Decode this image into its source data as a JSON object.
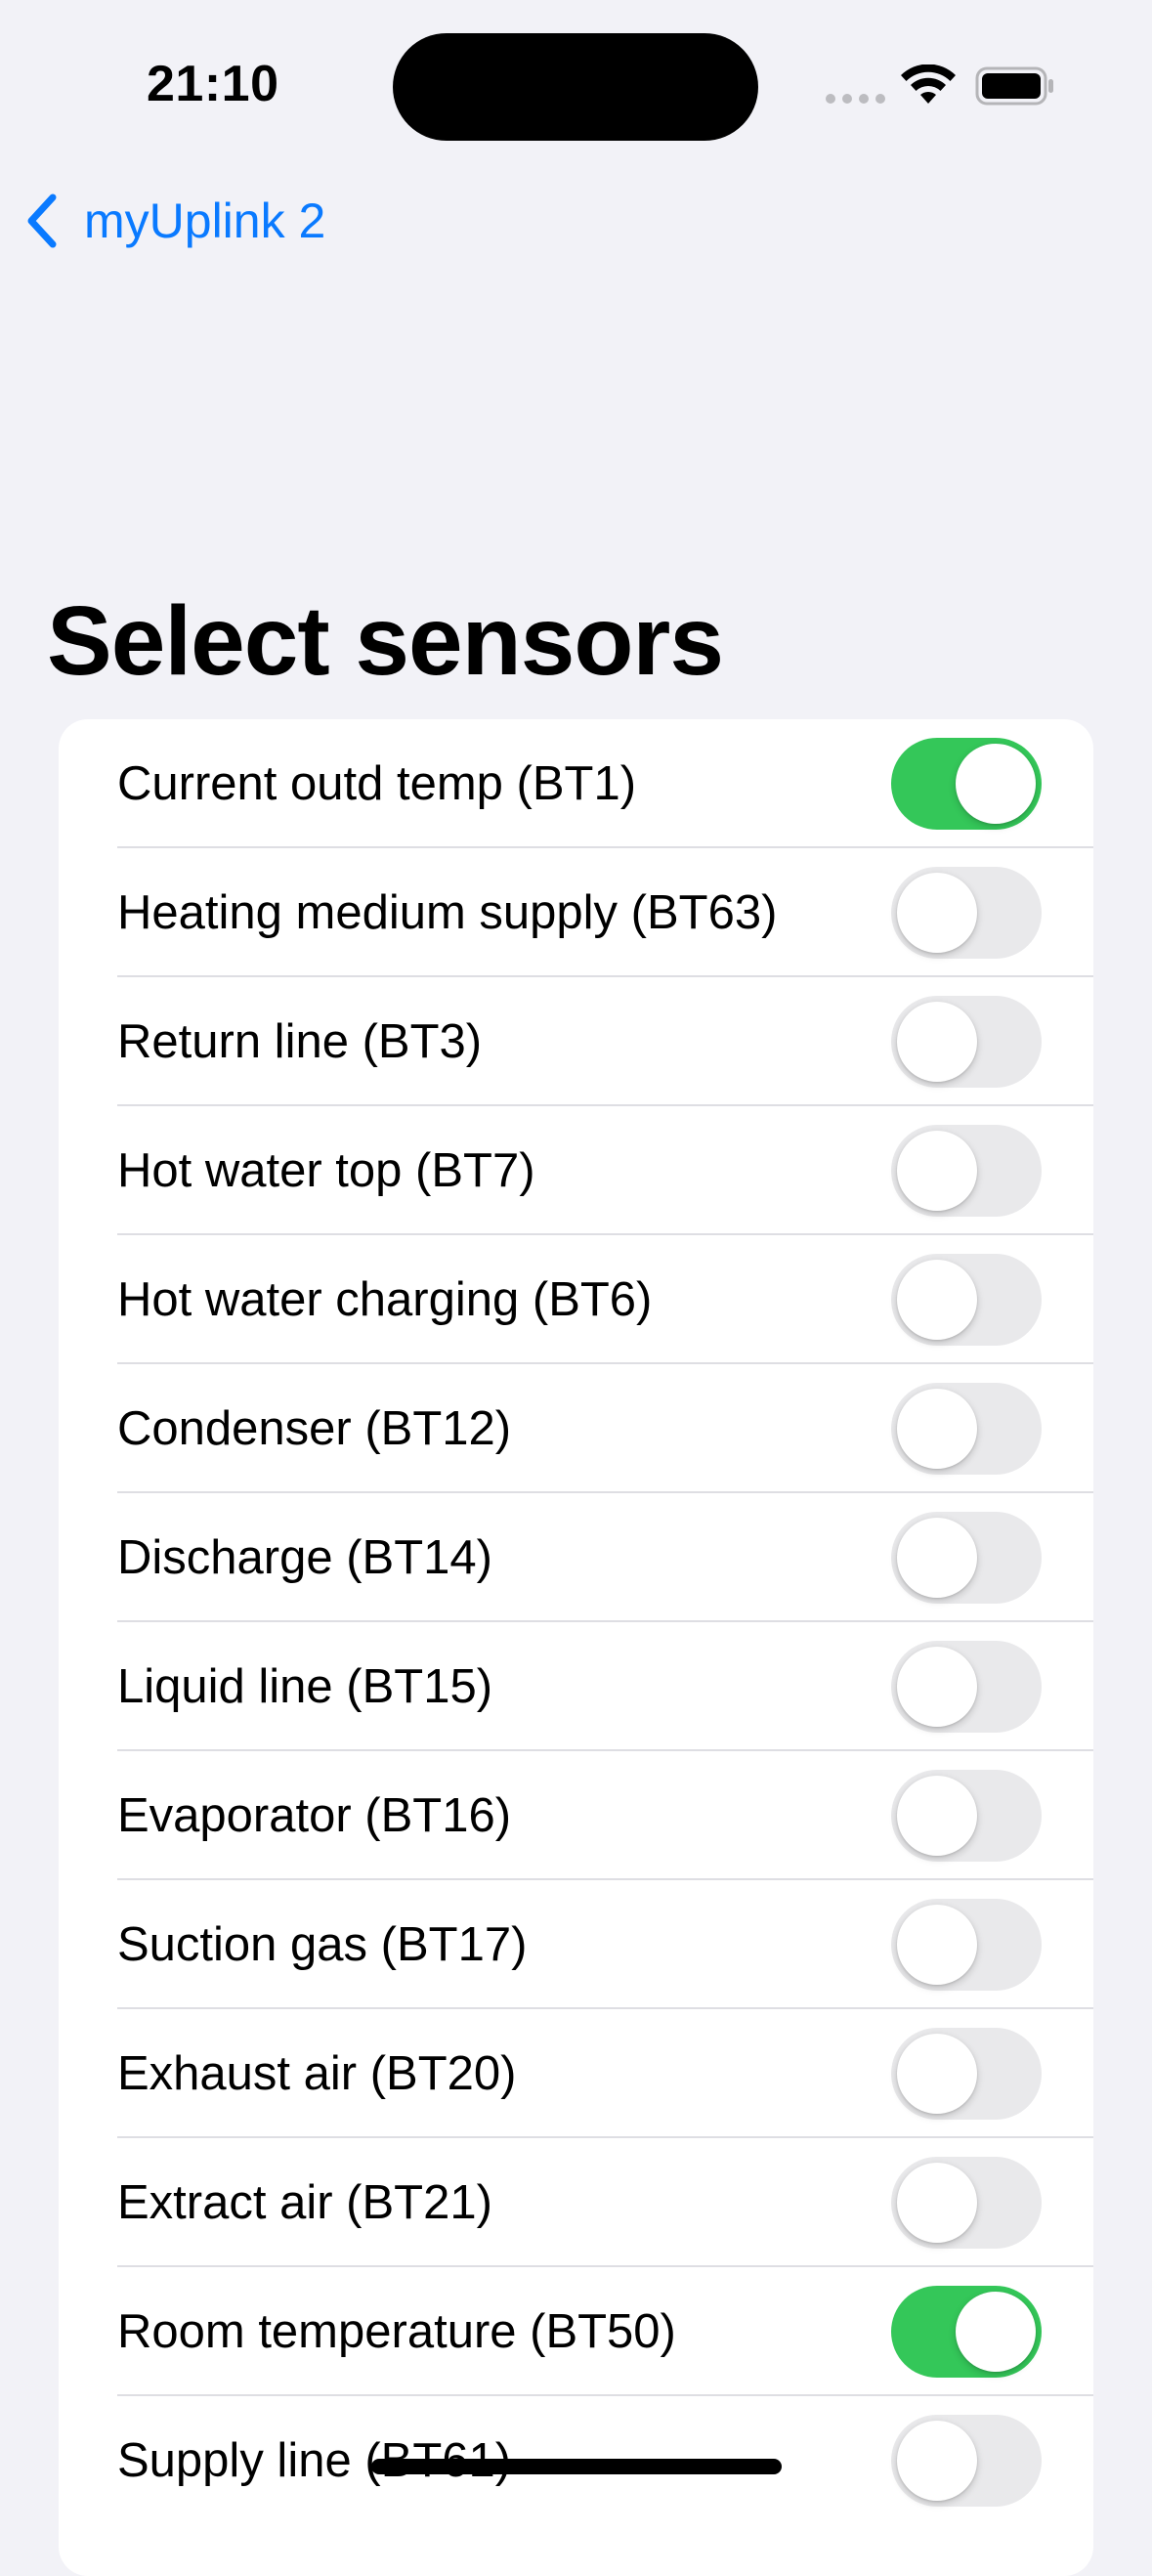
{
  "status_bar": {
    "time": "21:10"
  },
  "nav": {
    "back_label": "myUplink 2"
  },
  "page": {
    "title": "Select sensors"
  },
  "colors": {
    "accent": "#0a7aff",
    "toggle_on": "#34c759",
    "toggle_off": "#e9e9eb",
    "background": "#f2f2f7"
  },
  "sensors": [
    {
      "label": "Current outd temp (BT1)",
      "enabled": true
    },
    {
      "label": "Heating medium supply (BT63)",
      "enabled": false
    },
    {
      "label": "Return line (BT3)",
      "enabled": false
    },
    {
      "label": "Hot water top (BT7)",
      "enabled": false
    },
    {
      "label": "Hot water charging (BT6)",
      "enabled": false
    },
    {
      "label": "Condenser (BT12)",
      "enabled": false
    },
    {
      "label": "Discharge (BT14)",
      "enabled": false
    },
    {
      "label": "Liquid line (BT15)",
      "enabled": false
    },
    {
      "label": "Evaporator (BT16)",
      "enabled": false
    },
    {
      "label": "Suction gas (BT17)",
      "enabled": false
    },
    {
      "label": "Exhaust air (BT20)",
      "enabled": false
    },
    {
      "label": "Extract air (BT21)",
      "enabled": false
    },
    {
      "label": "Room temperature (BT50)",
      "enabled": true
    },
    {
      "label": "Supply line (BT61)",
      "enabled": false
    }
  ]
}
